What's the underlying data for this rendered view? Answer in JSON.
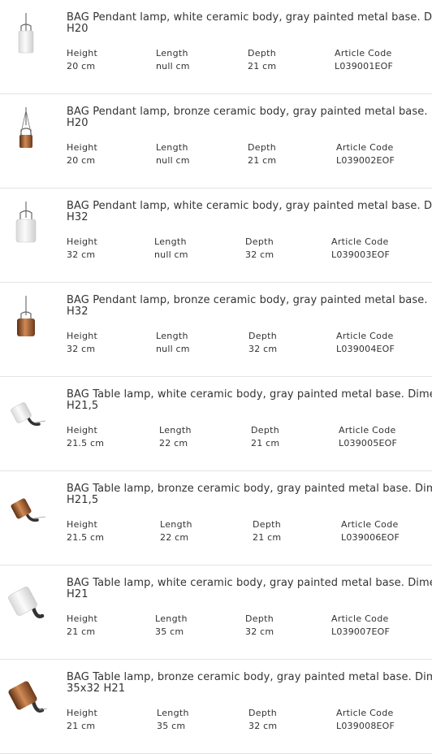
{
  "labels": {
    "height": "Height",
    "length": "Length",
    "depth": "Depth",
    "article_code": "Article Code"
  },
  "products": [
    {
      "title_line1": "BAG Pendant lamp, white ceramic body, gray painted metal base. Dim",
      "title_line2": "H20",
      "height": "20 cm",
      "length": "null cm",
      "depth": "21 cm",
      "article_code": "L039001EOF",
      "image": "pendant-lamp-small-white-icon",
      "shade_color": "#f2f2f2"
    },
    {
      "title_line1": "BAG Pendant lamp, bronze ceramic body, gray painted metal base. Di",
      "title_line2": "H20",
      "height": "20 cm",
      "length": "null cm",
      "depth": "21 cm",
      "article_code": "L039002EOF",
      "image": "pendant-lamp-small-bronze-icon",
      "shade_color": "#a0643a"
    },
    {
      "title_line1": "BAG Pendant lamp, white ceramic body, gray painted metal base. Dim",
      "title_line2": "H32",
      "height": "32 cm",
      "length": "null cm",
      "depth": "32 cm",
      "article_code": "L039003EOF",
      "image": "pendant-lamp-large-white-icon",
      "shade_color": "#f2f2f2"
    },
    {
      "title_line1": "BAG Pendant lamp, bronze ceramic body, gray painted metal base. Di",
      "title_line2": "H32",
      "height": "32 cm",
      "length": "null cm",
      "depth": "32 cm",
      "article_code": "L039004EOF",
      "image": "pendant-lamp-large-bronze-icon",
      "shade_color": "#a0643a"
    },
    {
      "title_line1": "BAG Table lamp, white ceramic body, gray painted metal base. Dimen",
      "title_line2": "H21,5",
      "height": "21.5 cm",
      "length": "22 cm",
      "depth": "21 cm",
      "article_code": "L039005EOF",
      "image": "table-lamp-small-white-icon",
      "shade_color": "#f2f2f2"
    },
    {
      "title_line1": "BAG Table lamp, bronze ceramic body, gray painted metal base. Dime",
      "title_line2": "H21,5",
      "height": "21.5 cm",
      "length": "22 cm",
      "depth": "21 cm",
      "article_code": "L039006EOF",
      "image": "table-lamp-small-bronze-icon",
      "shade_color": "#a0643a"
    },
    {
      "title_line1": "BAG Table lamp, white ceramic body, gray painted metal base. Dimen",
      "title_line2": "H21",
      "height": "21 cm",
      "length": "35 cm",
      "depth": "32 cm",
      "article_code": "L039007EOF",
      "image": "table-lamp-large-white-icon",
      "shade_color": "#f2f2f2"
    },
    {
      "title_line1": "BAG Table lamp, bronze ceramic body, gray painted metal base. Dime",
      "title_line2": "35x32 H21",
      "height": "21 cm",
      "length": "35 cm",
      "depth": "32 cm",
      "article_code": "L039008EOF",
      "image": "table-lamp-large-bronze-icon",
      "shade_color": "#a0643a"
    }
  ]
}
